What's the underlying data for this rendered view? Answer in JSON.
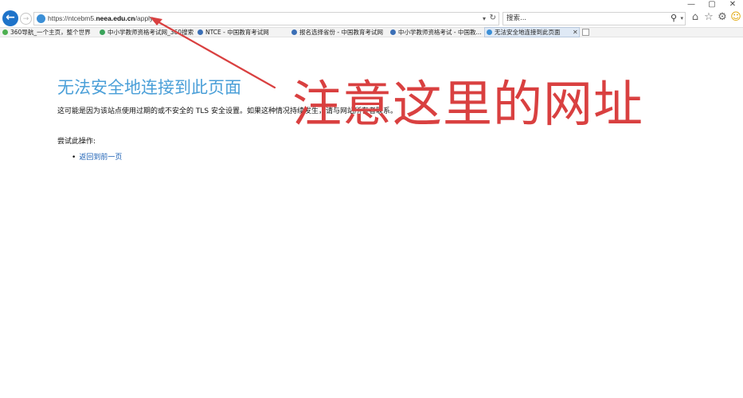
{
  "window": {
    "controls": [
      "—",
      "▢",
      "✕"
    ]
  },
  "addressbar": {
    "url_prefix": "https://ntcebm5.",
    "url_domain": "neea.edu.cn",
    "url_path": "/apply",
    "dropdown": "▾",
    "refresh": "↻"
  },
  "search": {
    "placeholder": "搜索...",
    "icon": "⚲",
    "dropdown": "▾"
  },
  "toolbar_icons": [
    "home-icon",
    "favorites-star-icon",
    "settings-gear-icon",
    "feedback-smiley-icon"
  ],
  "favorites": [
    {
      "label": "360导航_一个主页，整个世界",
      "color": "#4caf50"
    },
    {
      "label": "中小学教师资格考试网_360搜索",
      "color": "#3aa35a"
    },
    {
      "label": "NTCE - 中国教育考试网",
      "color": "#3b6fb6"
    },
    {
      "label": "报名选择省份 - 中国教育考试网",
      "color": "#3b6fb6"
    },
    {
      "label": "中小学教师资格考试 - 中国教...",
      "color": "#3b6fb6"
    }
  ],
  "active_tab": {
    "label": "无法安全地连接到此页面",
    "close": "✕"
  },
  "error_page": {
    "title": "无法安全地连接到此页面",
    "description": "这可能是因为该站点使用过期的或不安全的 TLS 安全设置。如果这种情况持续发生，请与网站所有者联系。",
    "try_label": "尝试此操作:",
    "back_link": "返回到前一页"
  },
  "annotation": {
    "text": "注意这里的网址",
    "color": "#d94040"
  }
}
